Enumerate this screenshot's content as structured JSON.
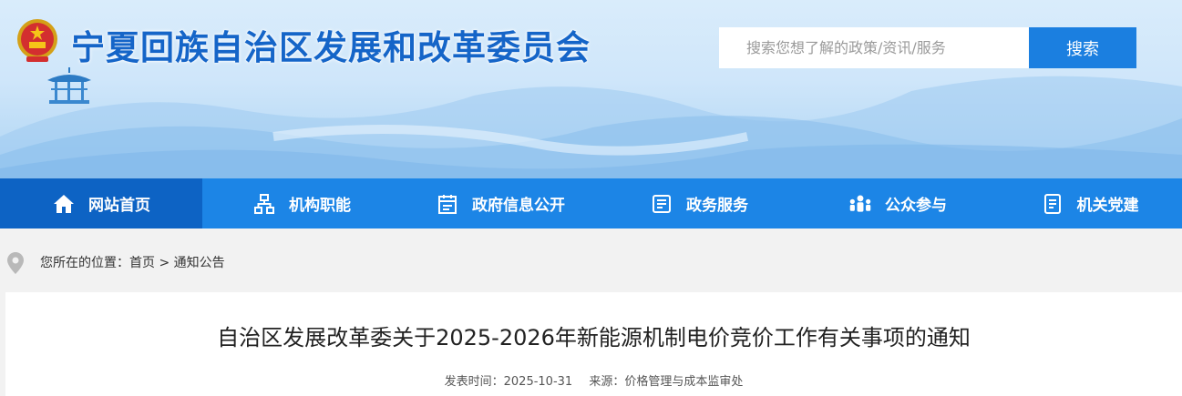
{
  "header": {
    "site_title": "宁夏回族自治区发展和改革委员会",
    "emblem_icon": "national-emblem-icon",
    "search_placeholder": "搜索您想了解的政策/资讯/服务",
    "search_button": "搜索"
  },
  "nav": {
    "items": [
      {
        "label": "网站首页",
        "icon": "home-icon",
        "active": true
      },
      {
        "label": "机构职能",
        "icon": "org-chart-icon",
        "active": false
      },
      {
        "label": "政府信息公开",
        "icon": "calendar-doc-icon",
        "active": false
      },
      {
        "label": "政务服务",
        "icon": "list-doc-icon",
        "active": false
      },
      {
        "label": "公众参与",
        "icon": "people-icon",
        "active": false
      },
      {
        "label": "机关党建",
        "icon": "document-icon",
        "active": false
      }
    ]
  },
  "breadcrumb": {
    "prefix": "您所在的位置：",
    "home": "首页",
    "separator": ">",
    "current": "通知公告"
  },
  "article": {
    "title": "自治区发展改革委关于2025-2026年新能源机制电价竞价工作有关事项的通知",
    "publish_label": "发表时间：",
    "publish_date": "2025-10-31",
    "source_label": "来源：",
    "source": "价格管理与成本监审处"
  },
  "colors": {
    "brand_blue": "#1c85e6",
    "nav_active": "#0d63c4",
    "title_blue": "#1565c8"
  }
}
